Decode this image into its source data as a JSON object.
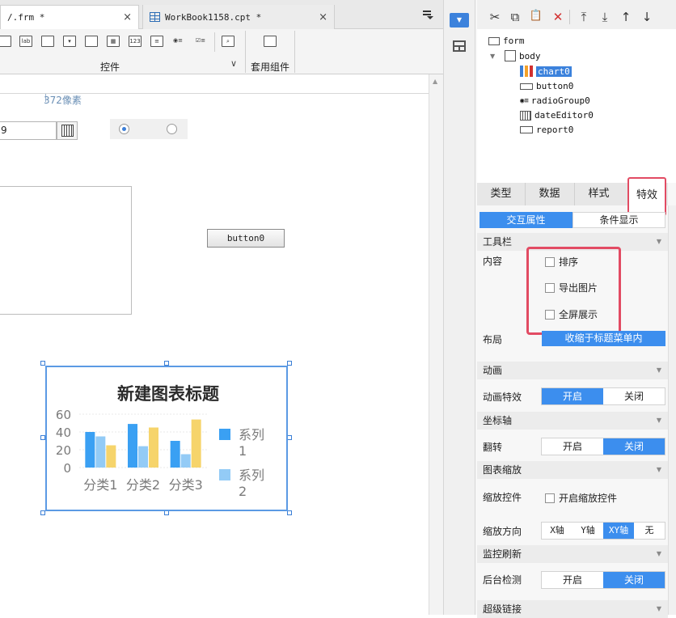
{
  "tabs": [
    {
      "label": "/.frm *",
      "close": "×"
    },
    {
      "label": "WorkBook1158.cpt *",
      "close": "×"
    }
  ],
  "tabbar": {
    "menu_icon": "tab-list-icon"
  },
  "toolbar": {
    "controls_label": "控件",
    "components_label": "套用组件",
    "expand_glyph": "∨",
    "icons": [
      "text-field-icon",
      "label-icon",
      "button-icon",
      "combo-icon",
      "frame-icon",
      "date-icon",
      "number-icon",
      "list-icon",
      "radio-icon",
      "checkbox-icon",
      "search-icon",
      "component-icon"
    ]
  },
  "canvas": {
    "px_label": "372像素",
    "date_value": "9",
    "button_label": "button0"
  },
  "chart_data": {
    "type": "bar",
    "title": "新建图表标题",
    "categories": [
      "分类1",
      "分类2",
      "分类3"
    ],
    "series": [
      {
        "name": "系列1",
        "values": [
          40,
          49,
          30
        ],
        "color": "#3aa0f3"
      },
      {
        "name": "",
        "values": [
          35,
          24,
          15
        ],
        "color": "#93cbf6"
      },
      {
        "name": "系列2",
        "values": [
          25,
          45,
          54
        ],
        "color": "#f6d46b"
      }
    ],
    "yticks": [
      0,
      20,
      40,
      60
    ],
    "ylim": [
      0,
      60
    ],
    "legend": [
      {
        "label": "系列1",
        "color": "#3aa0f3"
      },
      {
        "label": "系列2",
        "color": "#93cbf6"
      }
    ],
    "legend_placement": "right"
  },
  "tree": {
    "items": [
      {
        "label": "form"
      },
      {
        "label": "body"
      },
      {
        "label": "chart0"
      },
      {
        "label": "button0"
      },
      {
        "label": "radioGroup0"
      },
      {
        "label": "dateEditor0"
      },
      {
        "label": "report0"
      }
    ]
  },
  "panel_tools": {
    "cut": "✂",
    "copy": "⧉",
    "paste": "📋",
    "delete": "✕",
    "top": "⤒",
    "down": "⤓",
    "up": "↑",
    "bottom": "↓"
  },
  "prop_tabs": [
    "类型",
    "数据",
    "样式",
    "特效"
  ],
  "sub_tabs": [
    "交互属性",
    "条件显示"
  ],
  "sections": {
    "toolbar": {
      "title": "工具栏",
      "content_label": "内容",
      "options": [
        "排序",
        "导出图片",
        "全屏展示"
      ],
      "layout_label": "布局",
      "layout_value": "收缩于标题菜单内"
    },
    "animation": {
      "title": "动画",
      "effect_label": "动画特效",
      "on": "开启",
      "off": "关闭"
    },
    "axis": {
      "title": "坐标轴",
      "flip_label": "翻转",
      "on": "开启",
      "off": "关闭"
    },
    "zoom": {
      "title": "图表缩放",
      "control_label": "缩放控件",
      "control_option": "开启缩放控件",
      "dir_label": "缩放方向",
      "dirs": [
        "X轴",
        "Y轴",
        "XY轴",
        "无"
      ]
    },
    "monitor": {
      "title": "监控刷新",
      "bg_label": "后台检测",
      "on": "开启",
      "off": "关闭"
    },
    "hyperlink": {
      "title": "超级链接"
    }
  }
}
